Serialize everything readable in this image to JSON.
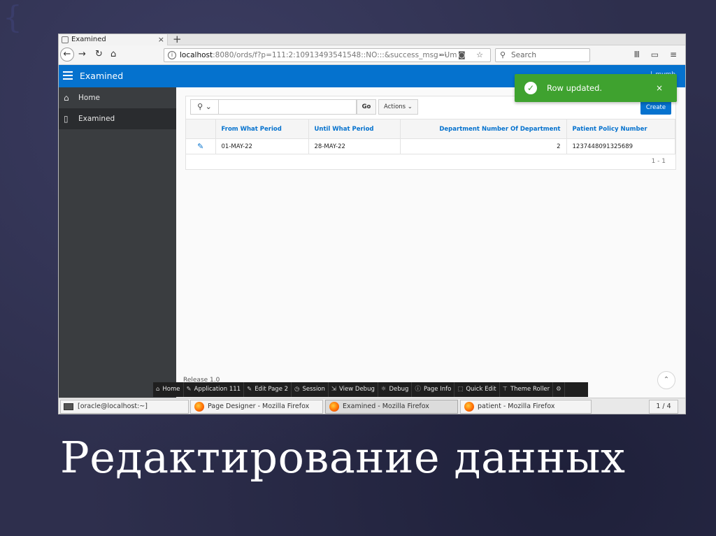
{
  "slide": {
    "title": "Редактирование данных"
  },
  "browser": {
    "tab_title": "Examined",
    "url_host": "localhost",
    "url_rest": ":8080/ords/f?p=111:2:10913493541548::NO:::&success_msg=Um",
    "search_placeholder": "Search"
  },
  "app": {
    "title": "Examined",
    "header_user": "l_mvmb"
  },
  "sidebar": {
    "items": [
      {
        "label": "Home",
        "icon": "home-icon"
      },
      {
        "label": "Examined",
        "icon": "document-icon"
      }
    ]
  },
  "report": {
    "go_label": "Go",
    "actions_label": "Actions",
    "create_label": "Create",
    "columns": [
      "From What Period",
      "Until What Period",
      "Department Number Of Department",
      "Patient Policy Number"
    ],
    "rows": [
      {
        "from": "01-MAY-22",
        "until": "28-MAY-22",
        "department": "2",
        "policy": "1237448091325689"
      }
    ],
    "pagination": "1 - 1"
  },
  "notification": {
    "message": "Row updated.",
    "close": "×",
    "color": "#3fa22f"
  },
  "footer": {
    "release": "Release 1.0"
  },
  "dev_toolbar": {
    "items": [
      "Home",
      "Application 111",
      "Edit Page 2",
      "Session",
      "View Debug",
      "Debug",
      "Page Info",
      "Quick Edit",
      "Theme Roller"
    ]
  },
  "taskbar": {
    "items": [
      "[oracle@localhost:~]",
      "Page Designer - Mozilla Firefox",
      "Examined - Mozilla Firefox",
      "patient - Mozilla Firefox"
    ],
    "pager": "1 / 4"
  },
  "colors": {
    "accent": "#0572ce",
    "slide_bg": "#2e2f4d"
  }
}
